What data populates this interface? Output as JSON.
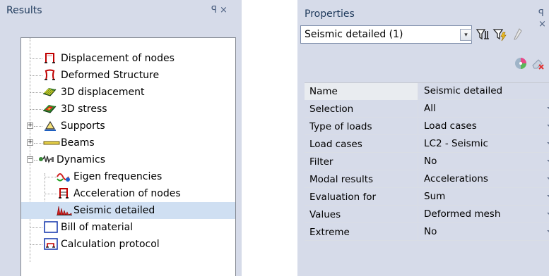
{
  "results": {
    "title": "Results",
    "title_icons": "ꟼ ×",
    "tree": [
      {
        "label": "Displacement of nodes",
        "icon": "displacement-nodes-icon"
      },
      {
        "label": "Deformed Structure",
        "icon": "deformed-structure-icon"
      },
      {
        "label": "3D displacement",
        "icon": "3d-displacement-icon"
      },
      {
        "label": "3D stress",
        "icon": "3d-stress-icon"
      },
      {
        "label": "Supports",
        "icon": "supports-icon"
      },
      {
        "label": "Beams",
        "icon": "beams-icon"
      },
      {
        "label": "Dynamics",
        "icon": "dynamics-icon"
      },
      {
        "label": "Eigen frequencies",
        "icon": "eigen-frequencies-icon"
      },
      {
        "label": "Acceleration of nodes",
        "icon": "acceleration-nodes-icon"
      },
      {
        "label": "Seismic detailed",
        "icon": "seismic-detailed-icon"
      },
      {
        "label": "Bill of material",
        "icon": "bill-of-material-icon"
      },
      {
        "label": "Calculation protocol",
        "icon": "calculation-protocol-icon"
      }
    ]
  },
  "properties": {
    "title": "Properties",
    "title_icons": "ꟼ ×",
    "selector_value": "Seismic detailed (1)",
    "selector_arrow": "▾",
    "rows": [
      {
        "name": "Name",
        "value": "Seismic detailed"
      },
      {
        "name": "Selection",
        "value": "All"
      },
      {
        "name": "Type of loads",
        "value": "Load cases"
      },
      {
        "name": "Load cases",
        "value": "LC2 - Seismic"
      },
      {
        "name": "Filter",
        "value": "No"
      },
      {
        "name": "Modal results",
        "value": "Accelerations"
      },
      {
        "name": "Evaluation for",
        "value": "Sum"
      },
      {
        "name": "Values",
        "value": "Deformed mesh"
      },
      {
        "name": "Extreme",
        "value": "No"
      }
    ]
  },
  "colors": {
    "panel_bg": "#d6dbe9",
    "title_text": "#1e395b",
    "selected_row": "#cfdff2"
  }
}
